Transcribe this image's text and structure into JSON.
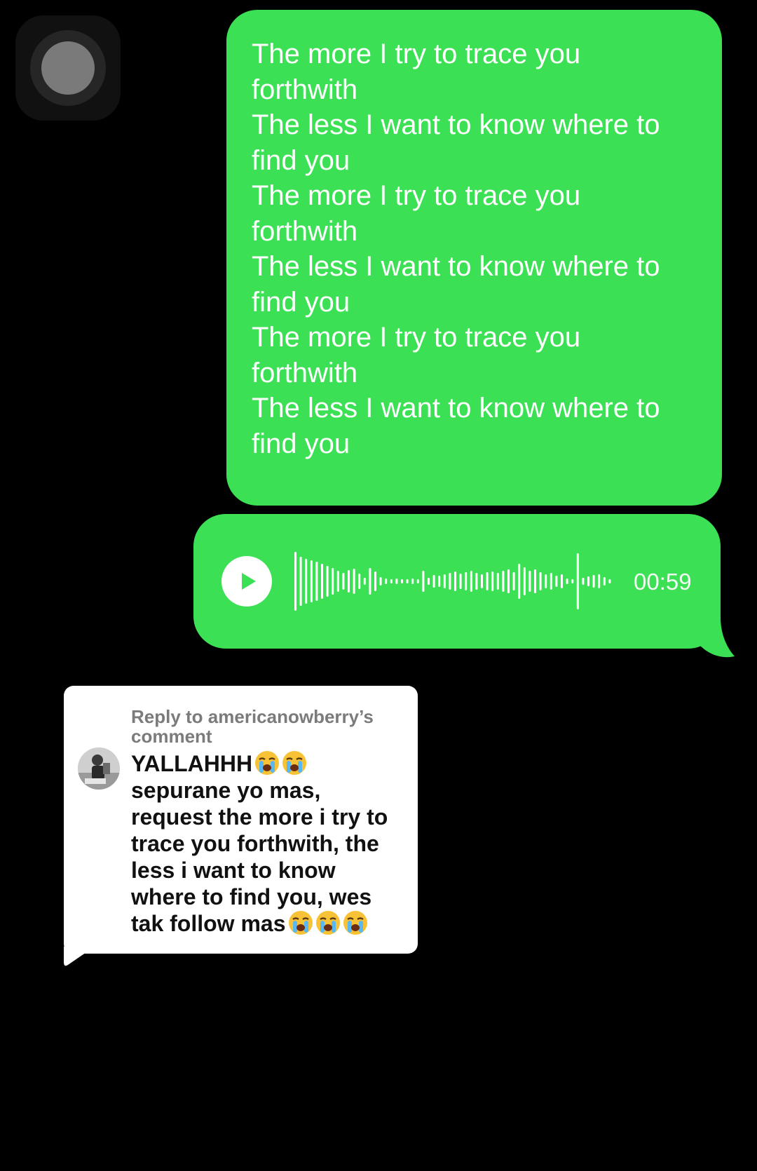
{
  "message": {
    "lines": [
      "The more I try to trace you",
      "forthwith",
      "The less I want to know where to",
      "find you",
      "The more I try to trace you",
      "forthwith",
      "The less I want to know where to",
      "find you",
      "The more I try to trace you",
      "forthwith",
      "The less I want to know where to",
      "find you"
    ]
  },
  "voice_message": {
    "duration": "00:59",
    "play_icon": "play-icon"
  },
  "reply": {
    "label": "Reply to americanowberry’s comment",
    "comment_lines": [
      "YALLAHHH",
      "sepurane yo mas,",
      "request the more i try to",
      "trace you forthwith, the",
      "less i want to know",
      "where to find you, wes",
      "tak follow mas"
    ],
    "emoji": "loudly-crying-face-icon"
  },
  "colors": {
    "bubble_green": "#3ce054",
    "background": "#000000",
    "card": "#ffffff"
  }
}
